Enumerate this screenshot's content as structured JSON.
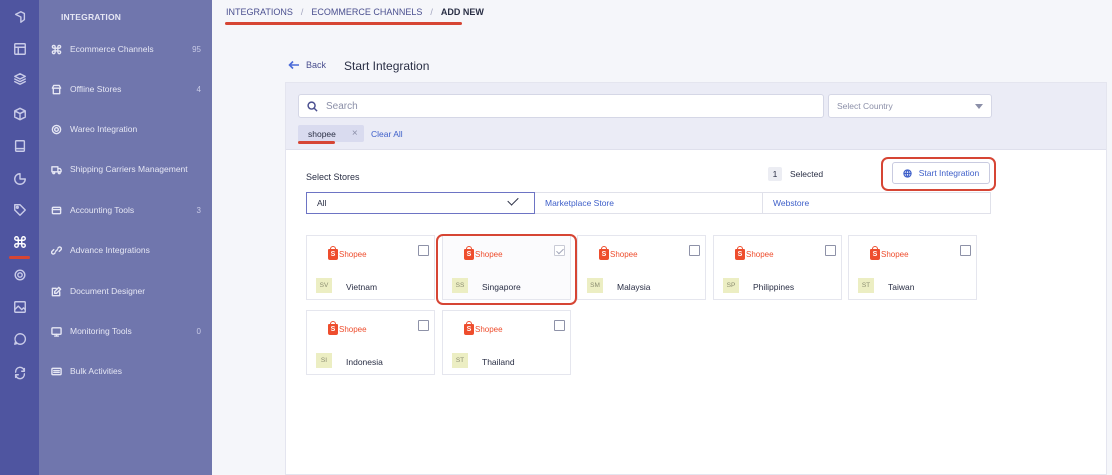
{
  "submenu": {
    "title": "INTEGRATION",
    "items": [
      {
        "label": "Ecommerce Channels",
        "count": "95",
        "icon": "command-icon"
      },
      {
        "label": "Offline Stores",
        "count": "4",
        "icon": "store-icon"
      },
      {
        "label": "Wareo Integration",
        "count": "",
        "icon": "settings-icon"
      },
      {
        "label": "Shipping Carriers Management",
        "count": "",
        "icon": "truck-icon"
      },
      {
        "label": "Accounting Tools",
        "count": "3",
        "icon": "wallet-icon"
      },
      {
        "label": "Advance Integrations",
        "count": "",
        "icon": "link-icon"
      },
      {
        "label": "Document Designer",
        "count": "",
        "icon": "edit-icon"
      },
      {
        "label": "Monitoring Tools",
        "count": "0",
        "icon": "monitor-icon"
      },
      {
        "label": "Bulk Activities",
        "count": "",
        "icon": "list-icon"
      }
    ]
  },
  "breadcrumb": {
    "items": [
      "INTEGRATIONS",
      "ECOMMERCE CHANNELS",
      "ADD NEW"
    ]
  },
  "header": {
    "back_label": "Back",
    "title": "Start Integration"
  },
  "filters": {
    "search_placeholder": "Search",
    "country_placeholder": "Select Country",
    "chip": "shopee",
    "clear_all": "Clear All"
  },
  "selection": {
    "label": "Select Stores",
    "count": "1",
    "selected_text": "Selected",
    "start_button": "Start Integration"
  },
  "tabs": [
    "All",
    "Marketplace Store",
    "Webstore"
  ],
  "stores": [
    {
      "brand": "Shopee",
      "abbr": "SV",
      "name": "Vietnam",
      "checked": false
    },
    {
      "brand": "Shopee",
      "abbr": "SS",
      "name": "Singapore",
      "checked": true
    },
    {
      "brand": "Shopee",
      "abbr": "SM",
      "name": "Malaysia",
      "checked": false
    },
    {
      "brand": "Shopee",
      "abbr": "SP",
      "name": "Philippines",
      "checked": false
    },
    {
      "brand": "Shopee",
      "abbr": "ST",
      "name": "Taiwan",
      "checked": false
    },
    {
      "brand": "Shopee",
      "abbr": "SI",
      "name": "Indonesia",
      "checked": false
    },
    {
      "brand": "Shopee",
      "abbr": "ST",
      "name": "Thailand",
      "checked": false
    }
  ],
  "colors": {
    "rail": "#4f55a0",
    "submenu": "#7076ad",
    "accent": "#3e5fc9",
    "highlight": "#d64534",
    "shopee": "#ee4d2d"
  }
}
